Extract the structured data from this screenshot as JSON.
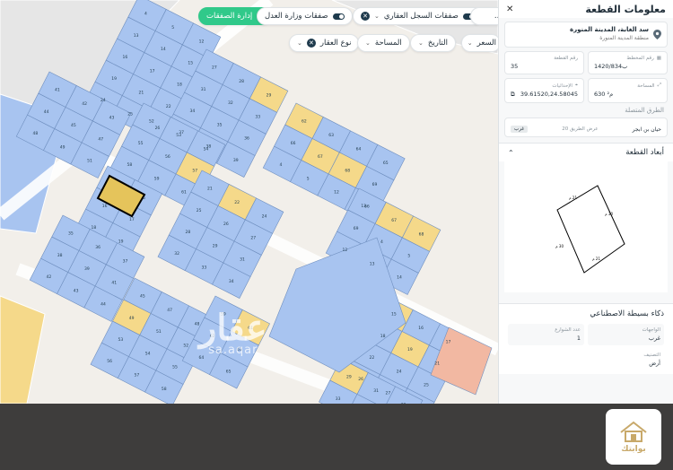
{
  "map": {
    "chips": {
      "add_deals": "إدارة الصفقات",
      "justice_deals": "صفقات وزارة العدل",
      "registry_deals": "صفقات السجل العقاري",
      "price": "السعر",
      "date": "التاريخ",
      "area": "المساحة",
      "property_type": "نوع العقار",
      "cut_label": "..."
    },
    "watermark": {
      "arabic": "عقار",
      "latin": "sa.aqar"
    },
    "parcel_labels": [
      "4",
      "5",
      "12",
      "13",
      "14",
      "15",
      "16",
      "17",
      "18",
      "19",
      "21",
      "22",
      "24",
      "25",
      "26",
      "27",
      "28",
      "29",
      "31",
      "32",
      "33",
      "34",
      "35",
      "36",
      "37",
      "38",
      "39",
      "41",
      "42",
      "43",
      "44",
      "45",
      "47",
      "48",
      "49",
      "51",
      "52",
      "53",
      "54",
      "55",
      "56",
      "57",
      "58",
      "59",
      "61",
      "62",
      "63",
      "64",
      "65",
      "66",
      "67",
      "68",
      "69"
    ],
    "colors": {
      "blue_parcel": "#a8c4f0",
      "yellow_parcel": "#f5d98a",
      "orange_parcel": "#f2b8a2",
      "selected_outline": "#000000"
    }
  },
  "panel": {
    "title": "معلومات القطعة",
    "location": {
      "line1": "سد الغابة، المدينة المنورة",
      "line2": "منطقة المدينة المنورة"
    },
    "fields": {
      "plan_label": "رقم المخطط",
      "plan_value": "1420/ب834",
      "parcel_label": "رقم القطعة",
      "parcel_value": "35",
      "area_label": "المساحة",
      "area_value": "630 م²",
      "coords_label": "الإحداثيات",
      "coords_value": "39.61520,24.58045"
    },
    "streets": {
      "section_title": "الطرق المتصلة",
      "width_header": "عرض الطريق",
      "name": "حيان بن ابجر",
      "width": "عرض الطريق 20",
      "direction": "غرب"
    },
    "dimensions": {
      "title": "أبعاد القطعة",
      "edges": [
        "21 م",
        "30 م",
        "21 م",
        "30 م"
      ]
    },
    "ai": {
      "title": "ذكاء بسيطة الاصطناعي",
      "facades_label": "الواجهات",
      "facades_value": "غرب",
      "streets_count_label": "عدد الشوارع",
      "streets_count_value": "1",
      "type_label": "التصنيف",
      "type_value": "أرض"
    }
  },
  "footer": {
    "logo_text": "بوابتك"
  }
}
